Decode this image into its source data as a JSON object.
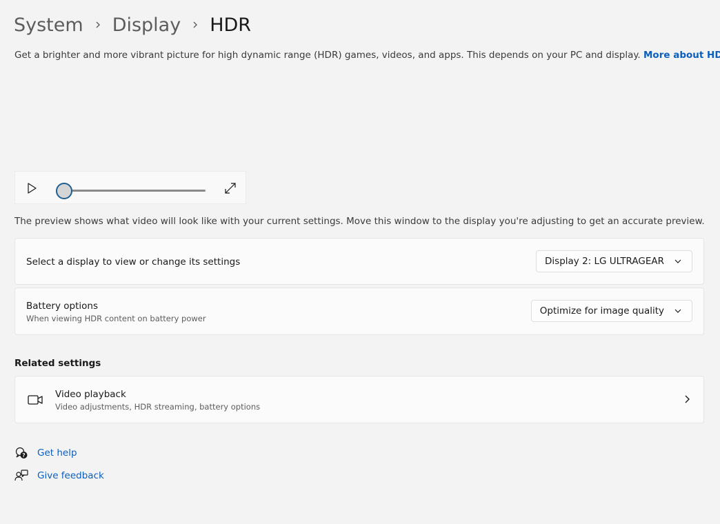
{
  "breadcrumb": {
    "items": [
      "System",
      "Display",
      "HDR"
    ]
  },
  "intro": {
    "text": "Get a brighter and more vibrant picture for high dynamic range (HDR) games, videos, and apps. This depends on your PC and display.",
    "link_label": "More about HDR"
  },
  "player": {
    "play_icon": "play-icon",
    "expand_icon": "expand-icon",
    "progress_fraction": 0
  },
  "preview_note": "The preview shows what video will look like with your current settings. Move this window to the display you're adjusting to get an accurate preview.",
  "display_select": {
    "label": "Select a display to view or change its settings",
    "value": "Display 2: LG ULTRAGEAR"
  },
  "battery": {
    "title": "Battery options",
    "subtitle": "When viewing HDR content on battery power",
    "value": "Optimize for image quality"
  },
  "related": {
    "heading": "Related settings",
    "items": [
      {
        "title": "Video playback",
        "subtitle": "Video adjustments, HDR streaming, battery options",
        "icon": "video-camera-icon"
      }
    ]
  },
  "help": {
    "get_help": "Get help",
    "give_feedback": "Give feedback"
  },
  "colors": {
    "background": "#f3f3f3",
    "card": "#fbfbfb",
    "link": "#0a5ebd",
    "accent": "#1e5e90"
  }
}
